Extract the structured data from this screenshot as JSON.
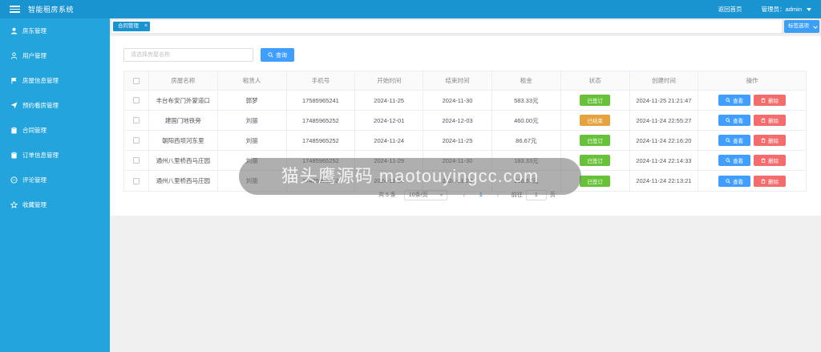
{
  "app": {
    "title": "智能租房系统"
  },
  "topbar": {
    "home_link": "返回首页",
    "admin_label": "管理员：admin"
  },
  "sidebar": {
    "items": [
      {
        "label": "房东管理",
        "icon": "user-solid-icon"
      },
      {
        "label": "用户管理",
        "icon": "user-outline-icon"
      },
      {
        "label": "房屋信息管理",
        "icon": "flag-icon"
      },
      {
        "label": "预约看房管理",
        "icon": "send-icon"
      },
      {
        "label": "合同管理",
        "icon": "clipboard-icon"
      },
      {
        "label": "订单信息管理",
        "icon": "clipboard-icon"
      },
      {
        "label": "评论管理",
        "icon": "chat-icon"
      },
      {
        "label": "收藏管理",
        "icon": "star-icon"
      }
    ]
  },
  "tabs": {
    "active": "合同管理",
    "close": "×",
    "options_label": "标签选项"
  },
  "search": {
    "placeholder": "请选择房屋名称",
    "button_label": "查询"
  },
  "table": {
    "headers": [
      "房屋名称",
      "租赁人",
      "手机号",
      "开始时间",
      "结束时间",
      "租金",
      "状态",
      "创建时间",
      "操作"
    ],
    "view_label": "查看",
    "delete_label": "删除",
    "rows": [
      {
        "house": "丰台布安门外蒙道口",
        "tenant": "郭梦",
        "phone": "17585965241",
        "start": "2024-11-25",
        "end": "2024-11-30",
        "rent": "583.33元",
        "status": "已签订",
        "created": "2024-11-25 21:21:47"
      },
      {
        "house": "建国门地铁旁",
        "tenant": "刘丽",
        "phone": "17485965252",
        "start": "2024-12-01",
        "end": "2024-12-03",
        "rent": "460.00元",
        "status": "已结束",
        "created": "2024-11-24 22:55:27"
      },
      {
        "house": "朝阳西坝河东里",
        "tenant": "刘丽",
        "phone": "17485965252",
        "start": "2024-11-24",
        "end": "2024-11-25",
        "rent": "86.67元",
        "status": "已签订",
        "created": "2024-11-24 22:16:20"
      },
      {
        "house": "通州八里桥西马庄园",
        "tenant": "刘丽",
        "phone": "17485965252",
        "start": "2024-11-29",
        "end": "2024-11-30",
        "rent": "183.33元",
        "status": "已签订",
        "created": "2024-11-24 22:14:33"
      },
      {
        "house": "通州八里桥西马庄园",
        "tenant": "刘丽",
        "phone": "17485965252",
        "start": "2024-11-24",
        "end": "2024-11-29",
        "rent": "916.67元",
        "status": "已签订",
        "created": "2024-11-24 22:13:21"
      }
    ]
  },
  "pagination": {
    "total": "共 5 条",
    "page_size": "10条/页",
    "prev": "‹",
    "current": "1",
    "next": "›",
    "goto_label": "前往",
    "goto_value": "1",
    "goto_suffix": "页"
  },
  "watermark": {
    "text": "猫头鹰源码 maotouyingcc.com"
  },
  "colors": {
    "topbar": "#1a93d1",
    "sidebar": "#23a4dc",
    "primary": "#409eff",
    "danger": "#f56c6c",
    "status_signed": "#67c23a",
    "status_ended": "#e6a23c"
  }
}
